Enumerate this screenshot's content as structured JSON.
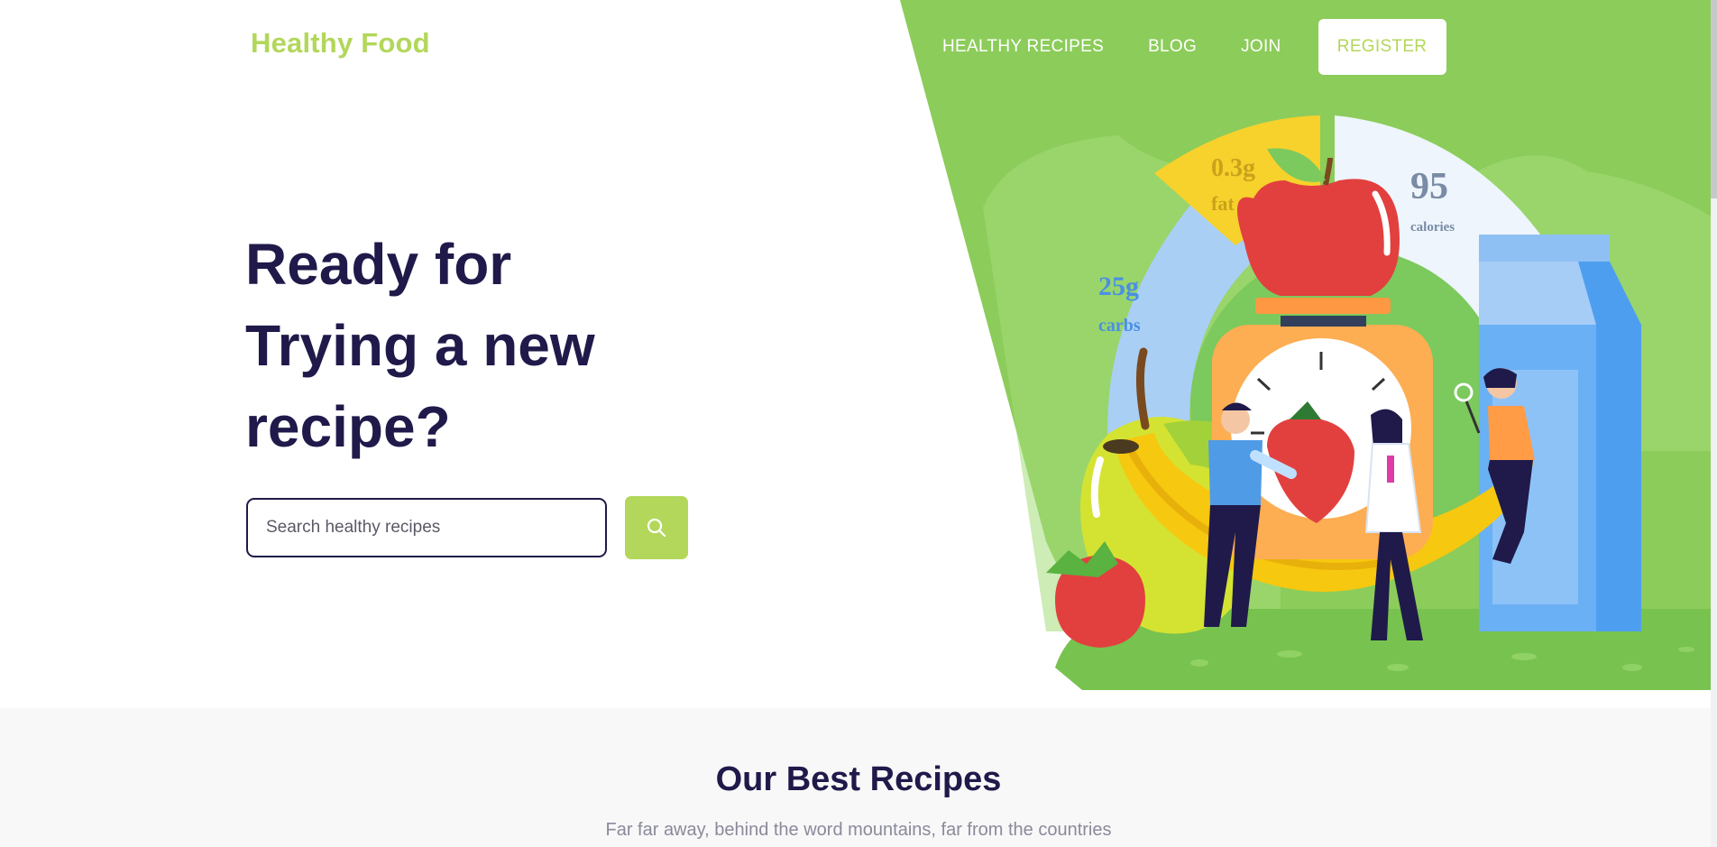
{
  "header": {
    "logo": "Healthy Food",
    "nav": [
      "HEALTHY RECIPES",
      "BLOG",
      "JOIN"
    ],
    "register_label": "REGISTER"
  },
  "hero": {
    "headline_lines": [
      "Ready for",
      "Trying a new",
      "recipe?"
    ],
    "search": {
      "placeholder": "Search healthy recipes"
    },
    "search_button_icon": "search-icon",
    "illustration": {
      "fat": {
        "value": "0.3g",
        "label": "fat"
      },
      "carbs": {
        "value": "25g",
        "label": "carbs"
      },
      "calories": {
        "value": "95",
        "label": "calories"
      }
    }
  },
  "recipes_section": {
    "title": "Our Best Recipes",
    "subtitle": "Far far away, behind the word mountains, far from the countries"
  },
  "colors": {
    "brand_green": "#b2d75a",
    "navy": "#1f1a4a",
    "panel_green": "#8ccc5a"
  }
}
